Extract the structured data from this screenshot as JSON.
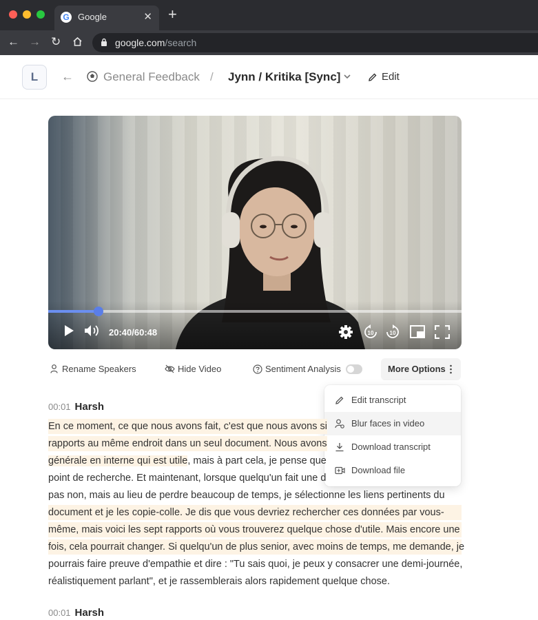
{
  "browser": {
    "tab_title": "Google",
    "url_host": "google.com",
    "url_path": "/search"
  },
  "header": {
    "logo_letter": "L",
    "project": "General Feedback",
    "separator": "/",
    "title": "Jynn / Kritika [Sync]",
    "edit_label": "Edit"
  },
  "player": {
    "time": "20:40/60:48",
    "progress": 0.122
  },
  "toolbar": {
    "rename_speakers": "Rename Speakers",
    "hide_video": "Hide Video",
    "sentiment_analysis": "Sentiment Analysis",
    "sentiment_enabled": false,
    "more_options": "More Options"
  },
  "menu": {
    "items": [
      {
        "label": "Edit transcript",
        "icon": "pencil-icon"
      },
      {
        "label": "Blur faces in video",
        "icon": "blur-face-icon"
      },
      {
        "label": "Download transcript",
        "icon": "download-icon"
      },
      {
        "label": "Download file",
        "icon": "video-file-icon"
      }
    ]
  },
  "transcript": [
    {
      "timestamp": "00:01",
      "speaker": "Harsh",
      "lines": [
        {
          "text": "En ce moment, ce que nous avons fait, c'est que nous avons si",
          "highlighted": true
        },
        {
          "text": "rapports au même endroit dans un seul document. Nous avons",
          "highlighted": true
        },
        {
          "text": "générale en interne qui est utile",
          "highlighted": true,
          "rest": ", mais à part cela, je pense que"
        },
        {
          "text": "point de recherche. Et maintenant, lorsque quelqu'un fait une d",
          "highlighted": false
        },
        {
          "text": "pas non, mais au lieu de perdre beaucoup de temps, je sélectionne les liens pertinents du",
          "highlighted": false
        },
        {
          "text": "document et je les copie-colle. Je dis que vous devriez rechercher ces données par vous-",
          "highlighted": true
        },
        {
          "text": "même, mais voici les sept rapports où vous trouverez quelque chose d'utile. Mais encore une",
          "highlighted": true
        },
        {
          "text": "fois, cela pourrait changer. Si quelqu'un de plus senior, avec moins de temps, me demande, je",
          "highlighted": true
        },
        {
          "text": "pourrais faire preuve d'empathie et dire : \"Tu sais quoi, je peux y consacrer une demi-journée,",
          "highlighted": false
        },
        {
          "text": "réalistiquement parlant\", et je rassemblerais alors rapidement quelque chose.",
          "highlighted": false
        }
      ]
    },
    {
      "timestamp": "00:01",
      "speaker": "Harsh",
      "lines": []
    }
  ]
}
